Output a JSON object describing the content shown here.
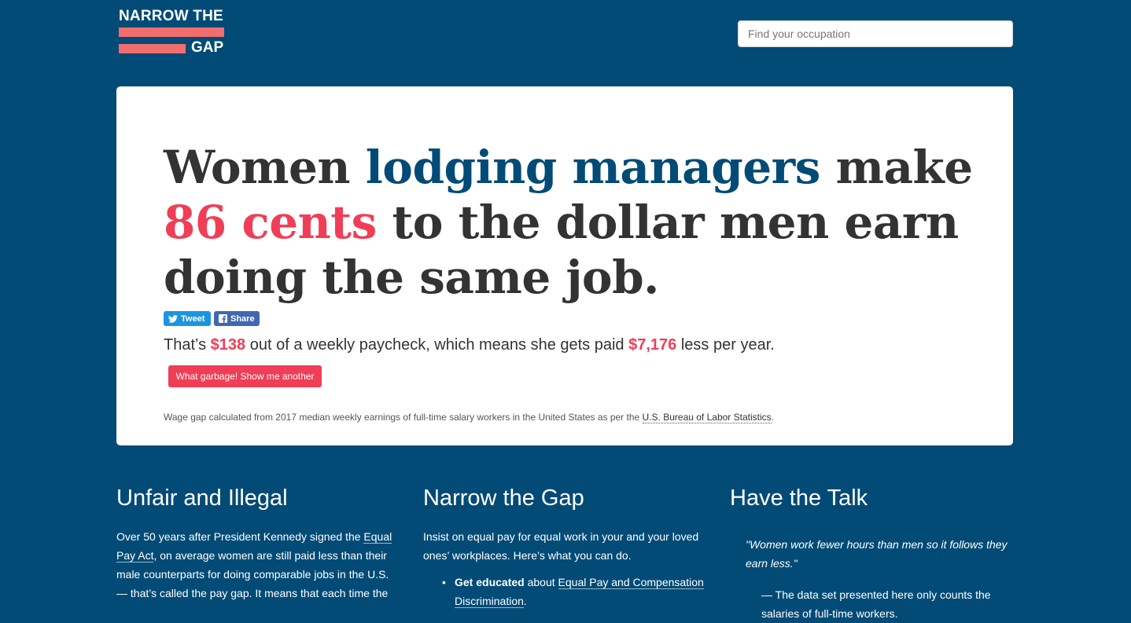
{
  "header": {
    "logo_line1": "NARROW THE",
    "logo_line2": "GAP",
    "search_placeholder": "Find your occupation"
  },
  "colors": {
    "background": "#024b76",
    "accent_red": "#f03e56",
    "logo_bar": "#f26d6d",
    "occupation_blue": "#024b76",
    "tweet_blue": "#1b95e0",
    "facebook_blue": "#4267b2"
  },
  "hero": {
    "headline_pre": "Women",
    "occupation": "lodging managers",
    "headline_mid": "make",
    "cents": "86 cents",
    "headline_post": "to the dollar men earn doing the same job.",
    "tweet_label": "Tweet",
    "share_label": "Share",
    "tweet_icon": "twitter-bird-icon",
    "share_icon": "facebook-icon",
    "paycheck_pre": "That’s",
    "weekly_amount": "$138",
    "paycheck_mid": "out of a weekly paycheck, which means she gets paid",
    "yearly_amount": "$7,176",
    "paycheck_post": "less per year.",
    "another_button": "What garbage! Show me another",
    "footnote_pre": "Wage gap calculated from 2017 median weekly earnings of full-time salary workers in the United States as per the",
    "footnote_link": "U.S. Bureau of Labor Statistics",
    "footnote_post": "."
  },
  "columns": {
    "unfair": {
      "title": "Unfair and Illegal",
      "p_pre": "Over 50 years after President Kennedy signed the",
      "p_link": "Equal Pay Act",
      "p_post": ", on average women are still paid less than their male counterparts for doing comparable jobs in the U.S. — that’s called the pay gap. It means that each time the"
    },
    "narrow": {
      "title": "Narrow the Gap",
      "intro": "Insist on equal pay for equal work in your and your loved ones’ workplaces. Here’s what you can do.",
      "item1_bold": "Get educated",
      "item1_mid": "about",
      "item1_link": "Equal Pay and Compensation Discrimination",
      "item1_post": "."
    },
    "talk": {
      "title": "Have the Talk",
      "quote": "\"Women work fewer hours than men so it follows they earn less.\"",
      "note": "— The data set presented here only counts the salaries of full-time workers."
    }
  }
}
